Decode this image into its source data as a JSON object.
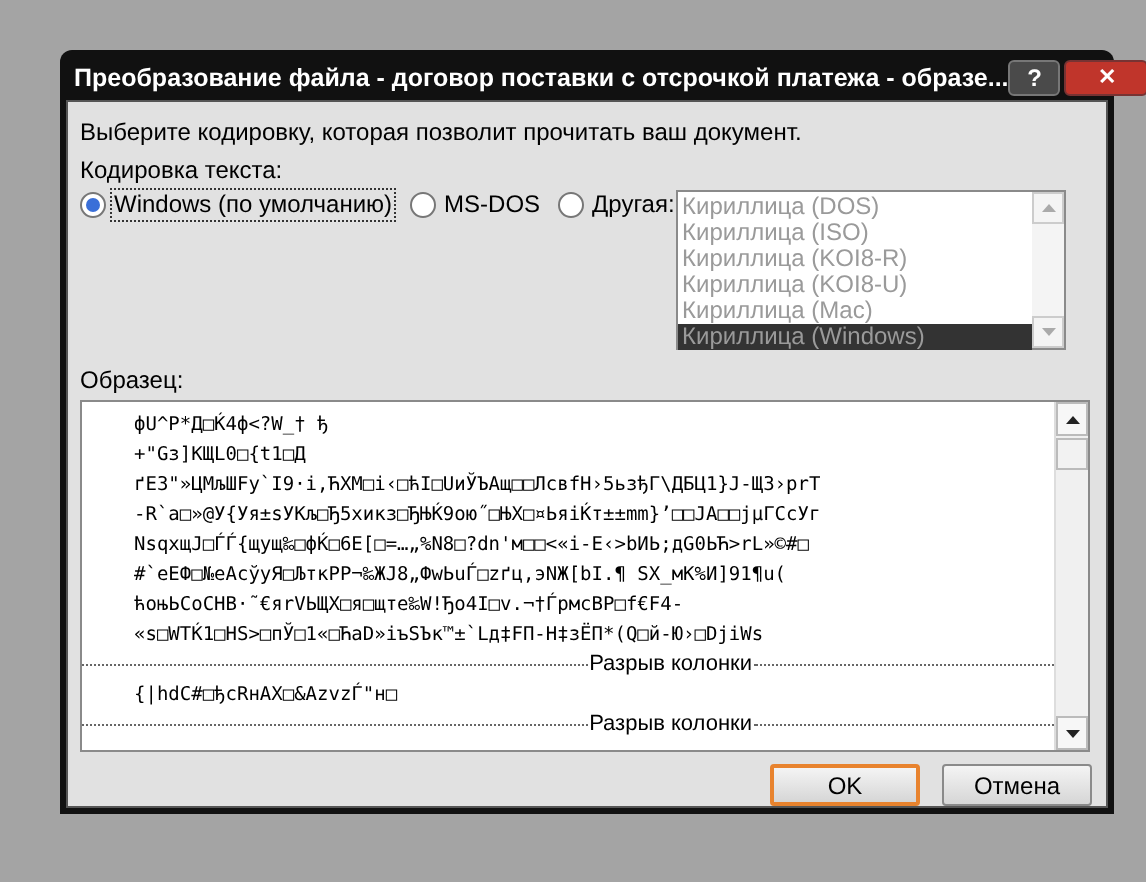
{
  "window": {
    "title": "Преобразование файла - договор поставки с отсрочкой платежа - образе...",
    "title_buttons": [
      "?",
      "✕"
    ]
  },
  "instruction": "Выберите кодировку, которая позволит прочитать ваш документ.",
  "encoding": {
    "label": "Кодировка текста:",
    "options": [
      {
        "label": "Windows (по умолчанию)",
        "selected": true
      },
      {
        "label": "MS-DOS",
        "selected": false
      },
      {
        "label": "Другая:",
        "selected": false
      }
    ],
    "list": {
      "disabled": true,
      "items": [
        {
          "label": "Кириллица (DOS)",
          "selected": false
        },
        {
          "label": "Кириллица (ISO)",
          "selected": false
        },
        {
          "label": "Кириллица (KOI8-R)",
          "selected": false
        },
        {
          "label": "Кириллица (KOI8-U)",
          "selected": false
        },
        {
          "label": "Кириллица (Mac)",
          "selected": false
        },
        {
          "label": "Кириллица (Windows)",
          "selected": true
        }
      ]
    }
  },
  "sample": {
    "label": "Образец:",
    "lines": [
      {
        "kind": "text",
        "text": "фU^P*Д□Ќ4ф<?W_† ђ"
      },
      {
        "kind": "text",
        "text": "+\"Gз]KЩL0□{t1□Д"
      },
      {
        "kind": "text",
        "text": "ґE3\"»ЦМљШFу`I9·і,ЋХМ□і‹□ћI□UиЎЪАщ□□ЛсвfН›5ьзђГ\\ДБЦ1}J-Щ3›prT"
      },
      {
        "kind": "text",
        "text": "-R`а□»@У{Уя±ѕУКљ□Ђ5хикз□ЂЊЌ9ою˝□ЊХ□¤ЬяіЌт±±mm}’□□JA□□jµГСсУг"
      },
      {
        "kind": "text",
        "text": "NsqхщJ□ЃЃ{щущ‰□фЌ□6Е[□=…„%N8□?dn'м□□<«і-Е‹>bИЬ;дG0ЬЋ>rL»©#□"
      },
      {
        "kind": "text",
        "text": "#`еЕФ□№еАсўуЯ□ЉткРР¬‰ЖJ8„ФwЬuЃ□zґц,эNЖ[bI.¶ SX_мК%И]91¶u("
      },
      {
        "kind": "text",
        "text": "ћоњЬСоСНВ·˜€яrVЬЩХ□я□щте‰W!Ђо4I□v.¬†ЃрмсВР□f€F4-"
      },
      {
        "kind": "text",
        "text": "«s□WTЌ1□НS>□пЎ□1«□ЋаD»іъЅЪк™±`Lд‡FП-Н‡зЁП*(Q□й-Ю›□DjiWs"
      },
      {
        "kind": "break",
        "text": "Разрыв колонки"
      },
      {
        "kind": "text",
        "text": "{|hdC#□ђcRнАХ□&AzvzЃ\"н□"
      },
      {
        "kind": "break",
        "text": "Разрыв колонки"
      }
    ]
  },
  "buttons": [
    {
      "label": "OK",
      "default": true
    },
    {
      "label": "Отмена",
      "default": false
    }
  ]
}
